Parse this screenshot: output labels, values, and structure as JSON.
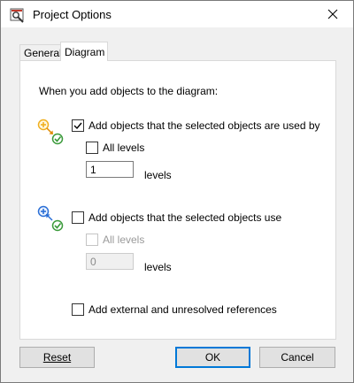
{
  "window": {
    "title": "Project Options",
    "icon": "app-icon"
  },
  "tabs": [
    {
      "label": "General",
      "active": false
    },
    {
      "label": "Diagram",
      "active": true
    }
  ],
  "panel": {
    "heading": "When you add objects to the diagram:",
    "option_used_by": {
      "label": "Add objects that the selected objects are used by",
      "checked": true,
      "icon": "used-by-icon",
      "all_levels_label": "All levels",
      "all_levels_checked": false,
      "levels_value": "1",
      "levels_label": "levels"
    },
    "option_use": {
      "label": "Add objects that the selected objects use",
      "checked": false,
      "icon": "uses-icon",
      "all_levels_label": "All levels",
      "all_levels_checked": false,
      "all_levels_disabled": true,
      "levels_value": "0",
      "levels_label": "levels"
    },
    "option_external": {
      "label": "Add external and unresolved references",
      "checked": false
    }
  },
  "buttons": {
    "reset_label": "Reset",
    "ok_label": "OK",
    "cancel_label": "Cancel"
  },
  "colors": {
    "accent": "#0078d7",
    "icon_yellow": "#f0b020",
    "icon_green": "#3a9a3a",
    "icon_blue": "#2b6fd6"
  }
}
